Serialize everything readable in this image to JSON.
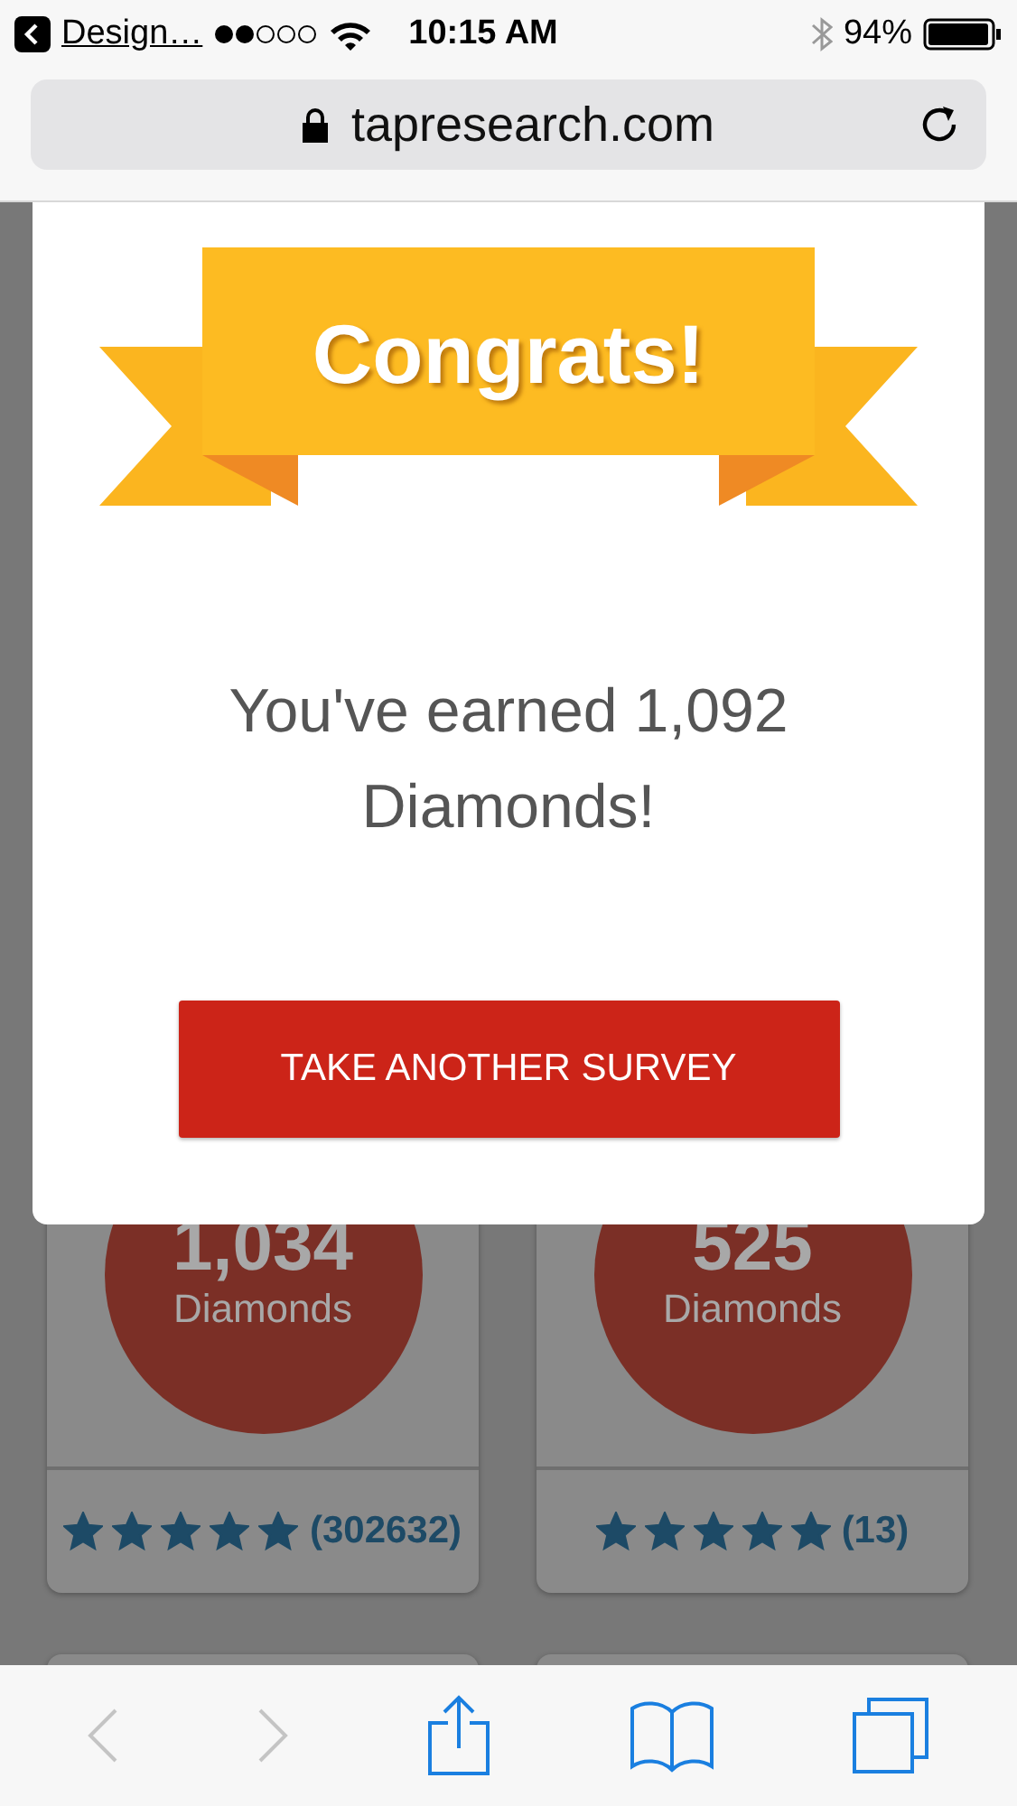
{
  "status_bar": {
    "back_app": "Design…",
    "time": "10:15 AM",
    "battery": "94%"
  },
  "address_bar": {
    "url": "tapresearch.com"
  },
  "modal": {
    "banner": "Congrats!",
    "message": "You've earned 1,092 Diamonds!",
    "button": "TAKE ANOTHER SURVEY"
  },
  "offers": [
    {
      "amount": "1,034",
      "unit": "Diamonds",
      "stars": 5,
      "reviews": "(302632)"
    },
    {
      "amount": "525",
      "unit": "Diamonds",
      "stars": 5,
      "reviews": "(13)"
    }
  ],
  "toolbar": {
    "back": {
      "disabled": true
    },
    "forward": {
      "disabled": true
    }
  }
}
